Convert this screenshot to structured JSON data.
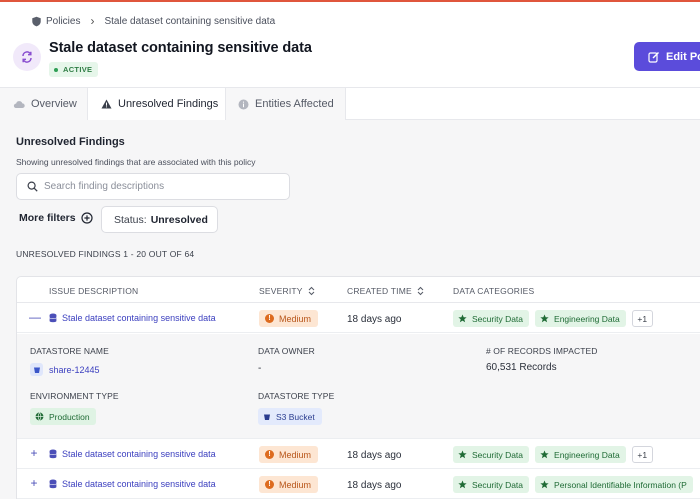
{
  "breadcrumb": {
    "root": "Policies",
    "current": "Stale dataset containing sensitive data"
  },
  "header": {
    "title": "Stale dataset containing sensitive data",
    "status": "ACTIVE",
    "edit_label": "Edit Po"
  },
  "tabs": [
    {
      "label": "Overview",
      "icon": "cloud-icon",
      "active": false
    },
    {
      "label": "Unresolved Findings",
      "icon": "warning-icon",
      "active": true
    },
    {
      "label": "Entities Affected",
      "icon": "info-icon",
      "active": false
    }
  ],
  "findings": {
    "title": "Unresolved Findings",
    "subtitle": "Showing unresolved findings that are associated with this policy",
    "search_placeholder": "Search finding descriptions",
    "more_filters": "More filters",
    "status_label": "Status:",
    "status_value": "Unresolved",
    "count_text": "UNRESOLVED FINDINGS 1 - 20 OUT OF 64"
  },
  "table": {
    "columns": [
      "ISSUE DESCRIPTION",
      "SEVERITY",
      "CREATED TIME",
      "DATA CATEGORIES"
    ],
    "rows": [
      {
        "toggle": "—",
        "issue": "Stale dataset containing sensitive data",
        "severity": "Medium",
        "created": "18 days ago",
        "cats": [
          "Security Data",
          "Engineering Data"
        ],
        "more": "+1"
      },
      {
        "toggle": "+",
        "issue": "Stale dataset containing sensitive data",
        "severity": "Medium",
        "created": "18 days ago",
        "cats": [
          "Security Data",
          "Engineering Data"
        ],
        "more": "+1"
      },
      {
        "toggle": "+",
        "issue": "Stale dataset containing sensitive data",
        "severity": "Medium",
        "created": "18 days ago",
        "cats": [
          "Security Data",
          "Personal Identifiable Information (P"
        ],
        "more": ""
      }
    ],
    "detail": {
      "datastore_name_label": "DATASTORE NAME",
      "datastore_name": "share-12445",
      "data_owner_label": "DATA OWNER",
      "data_owner": "-",
      "records_label": "# OF RECORDS IMPACTED",
      "records": "60,531 Records",
      "env_label": "ENVIRONMENT TYPE",
      "env": "Production",
      "ds_type_label": "DATASTORE TYPE",
      "ds_type": "S3 Bucket"
    }
  },
  "colors": {
    "accent": "#5b4cdb",
    "link": "#3b3fbf",
    "severity_medium": "#fde6d3",
    "category": "#e2f4e6"
  }
}
